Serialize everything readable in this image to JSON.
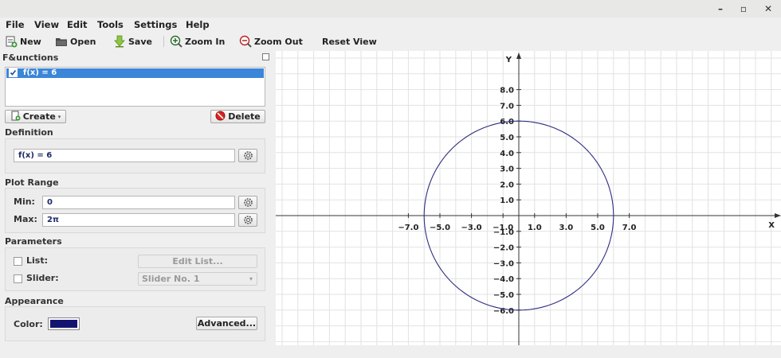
{
  "menu": {
    "items": [
      "File",
      "View",
      "Edit",
      "Tools",
      "Settings",
      "Help"
    ]
  },
  "window_controls": {
    "minimize": "–",
    "maximize": "▫",
    "close": "✕"
  },
  "toolbar": {
    "new_label": "New",
    "open_label": "Open",
    "save_label": "Save",
    "zoom_in_label": "Zoom In",
    "zoom_out_label": "Zoom Out",
    "reset_view_label": "Reset View"
  },
  "functions_panel": {
    "title": "F&unctions",
    "items": [
      {
        "label": "f(x) = 6",
        "checked": true,
        "selected": true
      }
    ],
    "create_label": "Create",
    "delete_label": "Delete"
  },
  "definition": {
    "title": "Definition",
    "value": "f(x) = 6"
  },
  "plot_range": {
    "title": "Plot Range",
    "min_label": "Min:",
    "min_value": "0",
    "max_label": "Max:",
    "max_value": "2π"
  },
  "parameters": {
    "title": "Parameters",
    "list_label": "List:",
    "edit_list_label": "Edit List...",
    "slider_label": "Slider:",
    "slider_value": "Slider No. 1"
  },
  "appearance": {
    "title": "Appearance",
    "color_label": "Color:",
    "color_value": "#141470",
    "advanced_label": "Advanced..."
  },
  "chart_data": {
    "type": "line",
    "curve": "polar r = 6, θ from 0 to 2π (circle)",
    "radius": 6,
    "theta_range": [
      0,
      6.2832
    ],
    "xlabel": "X",
    "ylabel": "Y",
    "x_ticks": [
      "−7.0",
      "−5.0",
      "−3.0",
      "−1.0",
      "1.0",
      "3.0",
      "5.0",
      "7.0"
    ],
    "y_ticks": [
      "8.0",
      "7.0",
      "6.0",
      "5.0",
      "4.0",
      "3.0",
      "2.0",
      "1.0",
      "−1.0",
      "−2.0",
      "−3.0",
      "−4.0",
      "−5.0",
      "−6.0"
    ],
    "grid": true,
    "curve_color": "#2d2d80"
  }
}
